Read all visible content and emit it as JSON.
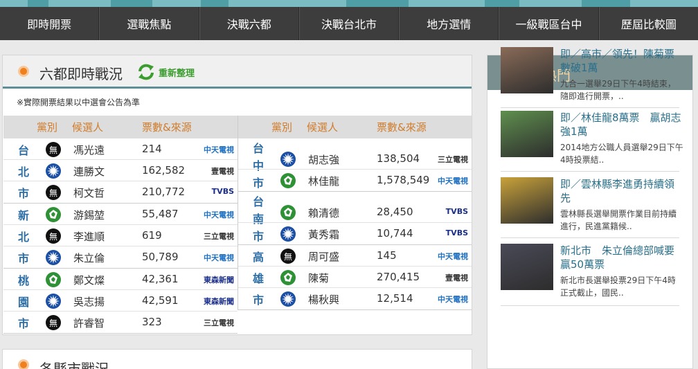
{
  "nav": [
    "即時開票",
    "選戰焦點",
    "決戰六都",
    "決戰台北市",
    "地方選情",
    "一級戰區台中",
    "歷屆比較圖"
  ],
  "main": {
    "title": "六都即時戰況",
    "refresh_label": "重新整理",
    "note": "※實際開票結果以中選會公告為準",
    "headers": {
      "party": "黨別",
      "candidate": "候選人",
      "votes": "票數&來源"
    },
    "left_table": [
      {
        "city": [
          "台",
          "北",
          "市"
        ],
        "rows": [
          {
            "party": "ind",
            "party_mark": "無",
            "name": "馮光遠",
            "votes": "214",
            "source": "中天電視",
            "source_color": "#1e70c0"
          },
          {
            "party": "kmt",
            "name": "連勝文",
            "votes": "162,582",
            "source": "壹電視",
            "source_color": "#333333"
          },
          {
            "party": "ind",
            "party_mark": "無",
            "name": "柯文哲",
            "votes": "210,772",
            "source": "TVBS",
            "source_color": "#1a2e8a"
          }
        ]
      },
      {
        "city": [
          "新",
          "北",
          "市"
        ],
        "rows": [
          {
            "party": "dpp",
            "name": "游錫堃",
            "votes": "55,487",
            "source": "中天電視",
            "source_color": "#1e70c0"
          },
          {
            "party": "ind",
            "party_mark": "無",
            "name": "李進順",
            "votes": "619",
            "source": "三立電視",
            "source_color": "#333333"
          },
          {
            "party": "kmt",
            "name": "朱立倫",
            "votes": "50,789",
            "source": "中天電視",
            "source_color": "#1e70c0"
          }
        ]
      },
      {
        "city": [
          "桃",
          "園",
          "市"
        ],
        "rows": [
          {
            "party": "dpp",
            "name": "鄭文燦",
            "votes": "42,361",
            "source": "東森新聞",
            "source_color": "#1a2e8a"
          },
          {
            "party": "kmt",
            "name": "吳志揚",
            "votes": "42,591",
            "source": "東森新聞",
            "source_color": "#1a2e8a"
          },
          {
            "party": "ind",
            "party_mark": "無",
            "name": "許睿智",
            "votes": "323",
            "source": "三立電視",
            "source_color": "#333333"
          }
        ]
      }
    ],
    "right_table": [
      {
        "city": [
          "台",
          "中",
          "市"
        ],
        "rows": [
          {
            "party": "kmt",
            "name": "胡志強",
            "votes": "138,504",
            "source": "三立電視",
            "source_color": "#333333"
          },
          {
            "party": "dpp",
            "name": "林佳龍",
            "votes": "1,578,549",
            "source": "中天電視",
            "source_color": "#1e70c0"
          }
        ]
      },
      {
        "city": [
          "台",
          "南",
          "市"
        ],
        "rows": [
          {
            "party": "dpp",
            "name": "賴清德",
            "votes": "28,450",
            "source": "TVBS",
            "source_color": "#1a2e8a"
          },
          {
            "party": "kmt",
            "name": "黃秀霜",
            "votes": "10,744",
            "source": "TVBS",
            "source_color": "#1a2e8a"
          }
        ]
      },
      {
        "city": [
          "高",
          "雄",
          "市"
        ],
        "rows": [
          {
            "party": "ind",
            "party_mark": "無",
            "name": "周可盛",
            "votes": "145",
            "source": "中天電視",
            "source_color": "#1e70c0"
          },
          {
            "party": "dpp",
            "name": "陳菊",
            "votes": "270,415",
            "source": "壹電視",
            "source_color": "#333333"
          },
          {
            "party": "kmt",
            "name": "楊秋興",
            "votes": "12,514",
            "source": "中天電視",
            "source_color": "#1e70c0"
          }
        ]
      }
    ]
  },
  "sidebar": {
    "title": "選戰最熱門",
    "items": [
      {
        "title": "即／高市／領先！陳菊票數破1萬",
        "snippet": "九合一選舉29日下午4時結束，隨即進行開票，..",
        "thumb_color": "#8a6b58"
      },
      {
        "title": "即／林佳龍8萬票　贏胡志強1萬",
        "snippet": "2014地方公職人員選舉29日下午4時投票結..",
        "thumb_color": "#5f8f4e"
      },
      {
        "title": "即／雲林縣李進勇持續領先",
        "snippet": "雲林縣長選舉開票作業目前持續進行，民進黨籍候..",
        "thumb_color": "#c9a23a"
      },
      {
        "title": "新北市　朱立倫總部喊要贏50萬票",
        "snippet": "新北市長選舉投票29日下午4時正式截止，國民..",
        "thumb_color": "#4a4a58"
      }
    ]
  },
  "next_section": {
    "title": "各縣市戰況"
  },
  "colors": {
    "nav_bg": "#3d3d3d",
    "accent_orange": "#f07f1d",
    "city_blue": "#2e6fa8",
    "header_orange": "#d07c2b",
    "sidebar_head": "#7a8f90"
  }
}
